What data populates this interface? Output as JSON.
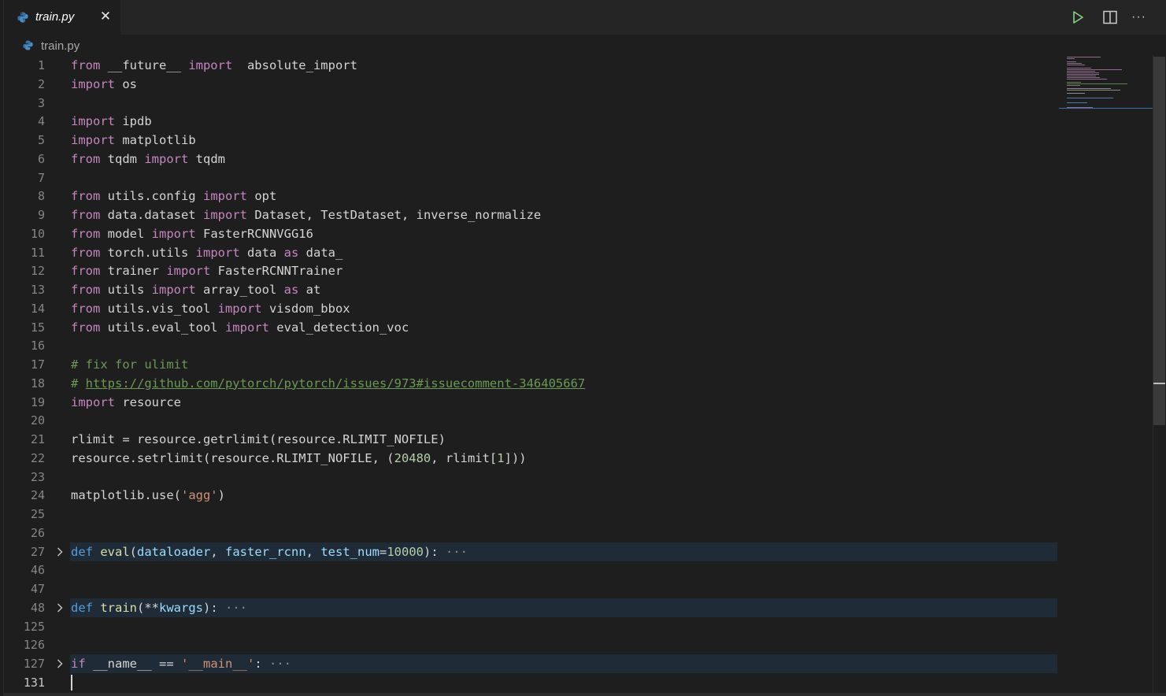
{
  "tab": {
    "label": "train.py",
    "icon": "python-icon",
    "close_glyph": "✕"
  },
  "toolbar": {
    "run": "play-icon",
    "split": "split-editor-icon",
    "more": "···"
  },
  "breadcrumb": {
    "label": "train.py"
  },
  "colors": {
    "background": "#1e1e1e",
    "keyword": "#569cd6",
    "control_keyword": "#c586c0",
    "function": "#dcdcaa",
    "parameter": "#9cdcfe",
    "number": "#b5cea8",
    "string": "#ce9178",
    "comment": "#6a9955",
    "fold_highlight": "#1f2c38"
  },
  "editor": {
    "lines": [
      {
        "n": "1",
        "t": [
          [
            "from",
            "ctl"
          ],
          [
            " __future__ ",
            ""
          ],
          [
            "import",
            "ctl"
          ],
          [
            "  absolute_import",
            ""
          ]
        ]
      },
      {
        "n": "2",
        "t": [
          [
            "import",
            "ctl"
          ],
          [
            " os",
            ""
          ]
        ]
      },
      {
        "n": "3",
        "t": []
      },
      {
        "n": "4",
        "t": [
          [
            "import",
            "ctl"
          ],
          [
            " ipdb",
            ""
          ]
        ]
      },
      {
        "n": "5",
        "t": [
          [
            "import",
            "ctl"
          ],
          [
            " matplotlib",
            ""
          ]
        ]
      },
      {
        "n": "6",
        "t": [
          [
            "from",
            "ctl"
          ],
          [
            " tqdm ",
            ""
          ],
          [
            "import",
            "ctl"
          ],
          [
            " tqdm",
            ""
          ]
        ]
      },
      {
        "n": "7",
        "t": []
      },
      {
        "n": "8",
        "t": [
          [
            "from",
            "ctl"
          ],
          [
            " utils.config ",
            ""
          ],
          [
            "import",
            "ctl"
          ],
          [
            " opt",
            ""
          ]
        ]
      },
      {
        "n": "9",
        "t": [
          [
            "from",
            "ctl"
          ],
          [
            " data.dataset ",
            ""
          ],
          [
            "import",
            "ctl"
          ],
          [
            " Dataset, TestDataset, inverse_normalize",
            ""
          ]
        ]
      },
      {
        "n": "10",
        "t": [
          [
            "from",
            "ctl"
          ],
          [
            " model ",
            ""
          ],
          [
            "import",
            "ctl"
          ],
          [
            " FasterRCNNVGG16",
            ""
          ]
        ]
      },
      {
        "n": "11",
        "t": [
          [
            "from",
            "ctl"
          ],
          [
            " torch.utils ",
            ""
          ],
          [
            "import",
            "ctl"
          ],
          [
            " data ",
            ""
          ],
          [
            "as",
            "ctl"
          ],
          [
            " data_",
            ""
          ]
        ]
      },
      {
        "n": "12",
        "t": [
          [
            "from",
            "ctl"
          ],
          [
            " trainer ",
            ""
          ],
          [
            "import",
            "ctl"
          ],
          [
            " FasterRCNNTrainer",
            ""
          ]
        ]
      },
      {
        "n": "13",
        "t": [
          [
            "from",
            "ctl"
          ],
          [
            " utils ",
            ""
          ],
          [
            "import",
            "ctl"
          ],
          [
            " array_tool ",
            ""
          ],
          [
            "as",
            "ctl"
          ],
          [
            " at",
            ""
          ]
        ]
      },
      {
        "n": "14",
        "t": [
          [
            "from",
            "ctl"
          ],
          [
            " utils.vis_tool ",
            ""
          ],
          [
            "import",
            "ctl"
          ],
          [
            " visdom_bbox",
            ""
          ]
        ]
      },
      {
        "n": "15",
        "t": [
          [
            "from",
            "ctl"
          ],
          [
            " utils.eval_tool ",
            ""
          ],
          [
            "import",
            "ctl"
          ],
          [
            " eval_detection_voc",
            ""
          ]
        ]
      },
      {
        "n": "16",
        "t": []
      },
      {
        "n": "17",
        "t": [
          [
            "# fix for ulimit",
            "cmt"
          ]
        ]
      },
      {
        "n": "18",
        "t": [
          [
            "# ",
            "cmt"
          ],
          [
            "https://github.com/pytorch/pytorch/issues/973#issuecomment-346405667",
            "link"
          ]
        ]
      },
      {
        "n": "19",
        "t": [
          [
            "import",
            "ctl"
          ],
          [
            " resource",
            ""
          ]
        ]
      },
      {
        "n": "20",
        "t": []
      },
      {
        "n": "21",
        "t": [
          [
            "rlimit = resource.getrlimit(resource.RLIMIT_NOFILE)",
            ""
          ]
        ]
      },
      {
        "n": "22",
        "t": [
          [
            "resource.setrlimit(resource.RLIMIT_NOFILE, (",
            ""
          ],
          [
            "20480",
            "num"
          ],
          [
            ", rlimit[",
            ""
          ],
          [
            "1",
            "num"
          ],
          [
            "]))",
            ""
          ]
        ]
      },
      {
        "n": "23",
        "t": []
      },
      {
        "n": "24",
        "t": [
          [
            "matplotlib.use(",
            ""
          ],
          [
            "'agg'",
            "str"
          ],
          [
            ")",
            ""
          ]
        ]
      },
      {
        "n": "25",
        "t": []
      },
      {
        "n": "26",
        "t": []
      },
      {
        "n": "27",
        "folded": true,
        "t": [
          [
            "def",
            "kw"
          ],
          [
            " ",
            ""
          ],
          [
            "eval",
            "fn"
          ],
          [
            "(",
            ""
          ],
          [
            "dataloader",
            "param"
          ],
          [
            ", ",
            ""
          ],
          [
            "faster_rcnn",
            "param"
          ],
          [
            ", ",
            ""
          ],
          [
            "test_num",
            "param"
          ],
          [
            "=",
            ""
          ],
          [
            "10000",
            "num"
          ],
          [
            "):",
            ""
          ],
          [
            " ···",
            "ell"
          ]
        ]
      },
      {
        "n": "46",
        "t": []
      },
      {
        "n": "47",
        "t": []
      },
      {
        "n": "48",
        "folded": true,
        "t": [
          [
            "def",
            "kw"
          ],
          [
            " ",
            ""
          ],
          [
            "train",
            "fn"
          ],
          [
            "(**",
            ""
          ],
          [
            "kwargs",
            "param"
          ],
          [
            "):",
            ""
          ],
          [
            " ···",
            "ell"
          ]
        ]
      },
      {
        "n": "125",
        "t": []
      },
      {
        "n": "126",
        "t": []
      },
      {
        "n": "127",
        "folded": true,
        "t": [
          [
            "if",
            "ctl"
          ],
          [
            " __name__ == ",
            ""
          ],
          [
            "'__main__'",
            "str"
          ],
          [
            ":",
            ""
          ],
          [
            " ···",
            "ell"
          ]
        ]
      },
      {
        "n": "131",
        "active": true,
        "t": []
      }
    ]
  }
}
